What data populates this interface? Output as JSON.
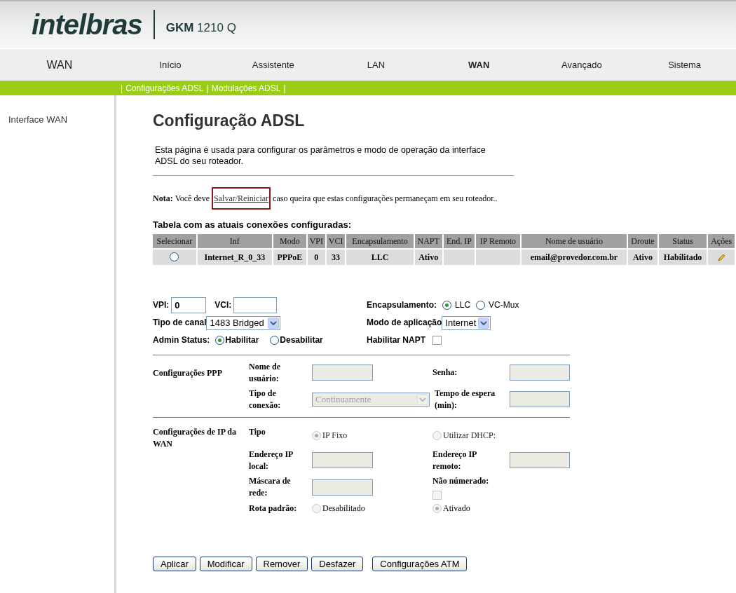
{
  "header": {
    "logo": "intelbras",
    "model": "**GKM** 1210 Q"
  },
  "nav": {
    "section": "WAN",
    "items": [
      {
        "label": "Início",
        "selected": false
      },
      {
        "label": "Assistente",
        "selected": false
      },
      {
        "label": "LAN",
        "selected": false
      },
      {
        "label": "WAN",
        "selected": true
      },
      {
        "label": "Avançado",
        "selected": false
      },
      {
        "label": "Sistema",
        "selected": false
      }
    ]
  },
  "submenu": {
    "separator": "|",
    "items": [
      "Configurações ADSL",
      "Modulações ADSL"
    ]
  },
  "sidebar": {
    "items": [
      "Interface WAN"
    ]
  },
  "page": {
    "title": "Configuração ADSL",
    "description": "Esta página é usada para configurar os parâmetros e modo de operação da interface ADSL do seu roteador.",
    "note": {
      "label": "Nota:",
      "before": "Você deve",
      "link": "Salvar/Reiniciar",
      "link_highlighted": true,
      "after": "caso queira que estas configurações permaneçam em seu roteador.."
    }
  },
  "table": {
    "title": "Tabela com as atuais conexões configuradas:",
    "columns": [
      "Selecionar",
      "Inf",
      "Modo",
      "VPI",
      "VCI",
      "Encapsulamento",
      "NAPT",
      "End. IP",
      "IP Remoto",
      "Nome de usuário",
      "Droute",
      "Status",
      "Ações"
    ],
    "rows": [
      {
        "selected": false,
        "cells": [
          "",
          "Internet_R_0_33",
          "PPPoE",
          "0",
          "33",
          "LLC",
          "Ativo",
          "",
          "",
          "email@provedor.com.br",
          "Ativo",
          "Habilitado"
        ]
      }
    ]
  },
  "form": {
    "vpi": {
      "label": "VPI:",
      "value": "0"
    },
    "vci": {
      "label": "VCI:"
    },
    "encapsulation": {
      "label": "Encapsulamento:",
      "options": [
        {
          "label": "LLC",
          "selected": true
        },
        {
          "label": "VC-Mux",
          "selected": false
        }
      ]
    },
    "channel_type": {
      "label": "Tipo de canal",
      "value": "1483 Bridged"
    },
    "app_mode": {
      "label": "Modo de aplicação",
      "value": "Internet"
    },
    "admin_status": {
      "label": "Admin Status:",
      "options": [
        {
          "label": "Habilitar",
          "selected": true
        },
        {
          "label": "Desabilitar",
          "selected": false
        }
      ]
    },
    "napt": {
      "label": "Habilitar NAPT",
      "checked": false
    }
  },
  "ppp": {
    "title": "Configurações PPP",
    "username": {
      "label": "Nome de usuário:",
      "disabled": true
    },
    "password": {
      "label": "Senha:",
      "disabled": true
    },
    "connection_type": {
      "label": "Tipo de conexão:",
      "value": "Continuamente",
      "disabled": true
    },
    "idle_time": {
      "label": "Tempo de espera (min):",
      "disabled": true
    }
  },
  "wan_ip": {
    "title": "Configurações de IP da WAN",
    "type": {
      "label": "Tipo",
      "options": [
        {
          "label": "IP Fixo",
          "selected": true
        },
        {
          "label": "Utilizar DHCP:",
          "selected": false
        }
      ],
      "disabled": true
    },
    "local_ip": {
      "label": "Endereço IP local:",
      "disabled": true
    },
    "remote_ip": {
      "label": "Endereço IP remoto:",
      "disabled": true
    },
    "netmask": {
      "label": "Máscara de rede:",
      "disabled": true
    },
    "unnumbered": {
      "label": "Não númerado:",
      "checked": false,
      "disabled": true
    },
    "default_route": {
      "label": "Rota padrão:",
      "options": [
        {
          "label": "Desabilitado",
          "selected": false
        },
        {
          "label": "Ativado",
          "selected": true
        }
      ],
      "disabled": true
    }
  },
  "buttons": [
    "Aplicar",
    "Modificar",
    "Remover",
    "Desfazer",
    "Configurações ATM"
  ]
}
